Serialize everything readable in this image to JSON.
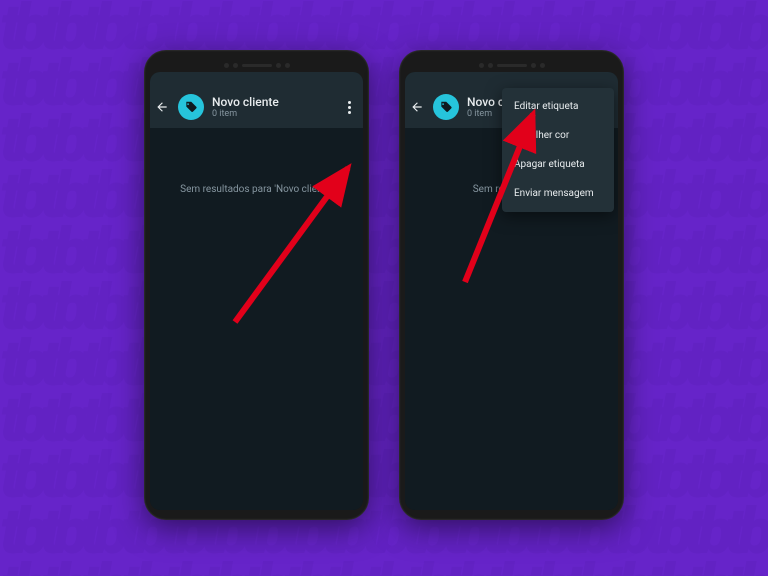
{
  "bg_pattern_text": "tbtbtbtbtbtbtbtbtbtbtbtbtbtbtbtbtbtbtbtbtbtbtbtbtbtbtbtbtbtbtbtbtbtbtbtbtbtbtbtbtbtbtbtbtbtbtbtbtbtbtbtbtbtbtbtbtbtbtbtbtbtbtbtbtbtbtbtbtbtbtbtbtbtbtbtbtbtbtbtbtbtbtbtbtbtbtbtbtbtbtbtbtbtbtbtbtbtbtbtbtbtbtbtbtbtbtbtbtbtbtbtbtbtbtbtbtbtbtbtbtbtbtbtbtbtbtbtbtbtbtbtbtbtbtbtbtbtbtbtbtbtbtbtbtbtbtbtbtbtbtbtbtbtbtbtbtbtbtbtbtbtbtbtbtbtbtbtbtbtbtbtbtbtbtbtbtbtbtbtbtbtbtbtbtbtbtbtbtbtbtbtbtbtbtbtbtbtbtbtbtbtbtbtbtbtbtbtbtbtbtbtbtbtbtbtbtbtbtbtbtbtbtbtbtbtbtbtbtbtbtbtbtbtbtbtbtbtbtbtbtbtbtbtbtbtbtbtbtbtbtbtbtbtbtbtbtbtbtbtbtbtbtbtbtbtbtbtbtbtbtbtbtbtbtbtb",
  "phone1": {
    "header": {
      "title": "Novo cliente",
      "subtitle": "0 item"
    },
    "body": {
      "empty": "Sem resultados para 'Novo cliente'"
    }
  },
  "phone2": {
    "header": {
      "title": "Novo cliente",
      "subtitle": "0 item"
    },
    "body": {
      "empty": "Sem resultados p"
    },
    "menu": {
      "items": [
        "Editar etiqueta",
        "Escolher cor",
        "Apagar etiqueta",
        "Enviar mensagem"
      ]
    }
  }
}
